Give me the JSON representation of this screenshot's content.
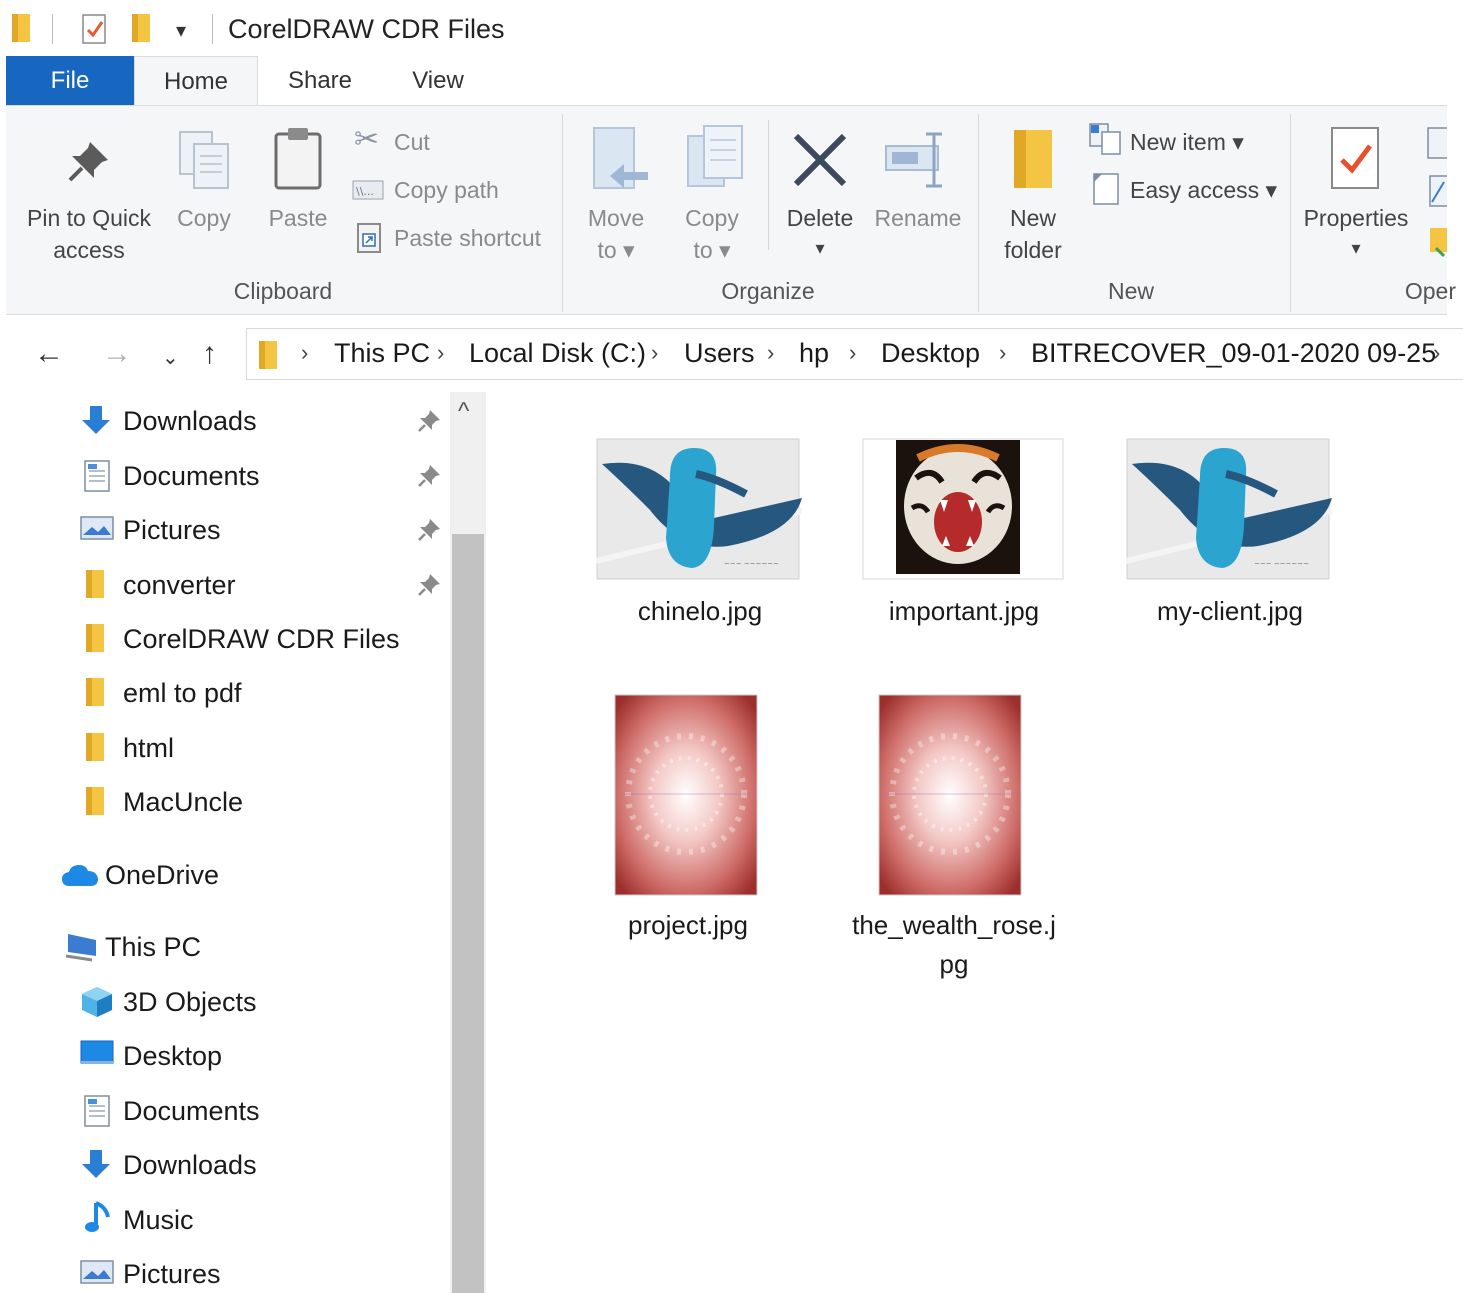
{
  "window": {
    "title": "CorelDRAW CDR Files"
  },
  "tabs": [
    "File",
    "Home",
    "Share",
    "View"
  ],
  "ribbon": {
    "clipboard": {
      "pin": "Pin to Quick\naccess",
      "copy": "Copy",
      "paste": "Paste",
      "cut": "Cut",
      "copy_path": "Copy path",
      "paste_shortcut": "Paste shortcut",
      "group": "Clipboard"
    },
    "organize": {
      "move_to": "Move\nto ▾",
      "copy_to": "Copy\nto ▾",
      "delete": "Delete",
      "delete_arrow": "▾",
      "rename": "Rename",
      "group": "Organize"
    },
    "new": {
      "new_folder": "New\nfolder",
      "new_item": "New item ▾",
      "easy_access": "Easy access ▾",
      "group": "New"
    },
    "open": {
      "properties": "Properties",
      "properties_arrow": "▾",
      "group": "Oper"
    }
  },
  "address": {
    "crumbs": [
      "This PC",
      "Local Disk (C:)",
      "Users",
      "hp",
      "Desktop",
      "BITRECOVER_09-01-2020 09-25"
    ]
  },
  "nav": {
    "quick_access": [
      {
        "label": "Downloads",
        "icon": "download-arrow-icon",
        "pinned": true
      },
      {
        "label": "Documents",
        "icon": "document-icon",
        "pinned": true
      },
      {
        "label": "Pictures",
        "icon": "pictures-icon",
        "pinned": true
      },
      {
        "label": "converter",
        "icon": "folder-icon",
        "pinned": true
      },
      {
        "label": "CorelDRAW CDR Files",
        "icon": "folder-icon",
        "pinned": false
      },
      {
        "label": "eml to pdf",
        "icon": "folder-icon",
        "pinned": false
      },
      {
        "label": "html",
        "icon": "folder-icon",
        "pinned": false
      },
      {
        "label": "MacUncle",
        "icon": "folder-icon",
        "pinned": false
      }
    ],
    "onedrive": "OneDrive",
    "this_pc": "This PC",
    "this_pc_items": [
      {
        "label": "3D Objects",
        "icon": "3d-objects-icon"
      },
      {
        "label": "Desktop",
        "icon": "desktop-icon"
      },
      {
        "label": "Documents",
        "icon": "document-icon"
      },
      {
        "label": "Downloads",
        "icon": "download-arrow-icon"
      },
      {
        "label": "Music",
        "icon": "music-note-icon"
      },
      {
        "label": "Pictures",
        "icon": "pictures-icon"
      }
    ]
  },
  "files": [
    {
      "name": "chinelo.jpg",
      "thumb": "blue-shoe"
    },
    {
      "name": "important.jpg",
      "thumb": "tiger"
    },
    {
      "name": "my-client.jpg",
      "thumb": "blue-shoe"
    },
    {
      "name": "project.jpg",
      "thumb": "rose-pattern"
    },
    {
      "name": "the_wealth_rose.j\npg",
      "thumb": "rose-pattern"
    }
  ],
  "colors": {
    "file_tab": "#1767c0",
    "folder": "#f4c542",
    "accent": "#1e88e5"
  }
}
